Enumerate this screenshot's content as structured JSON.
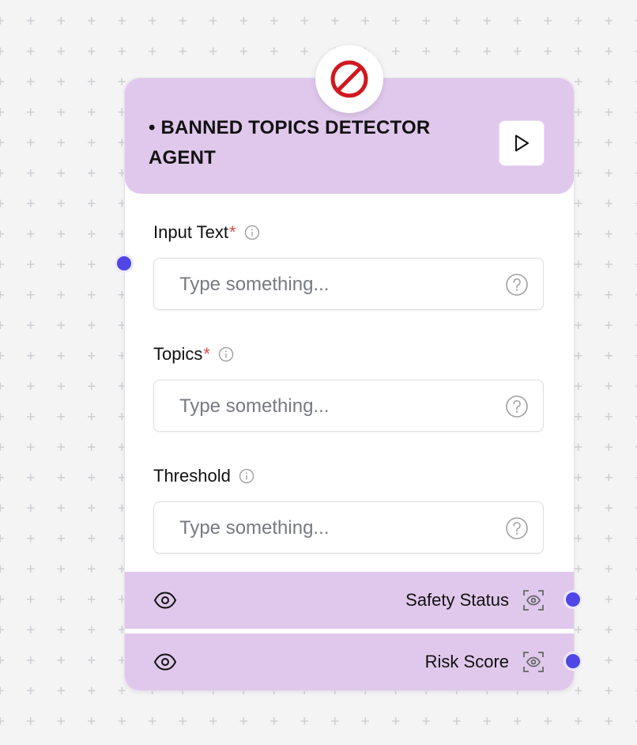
{
  "node": {
    "title": "• BANNED TOPICS DETECTOR AGENT",
    "badge_icon": "no-entry-icon",
    "run_icon": "play-icon",
    "accent_color": "#e0c8ec",
    "handle_color": "#4f46e5"
  },
  "fields": {
    "input_text": {
      "label": "Input Text",
      "required_mark": "*",
      "placeholder": "Type something..."
    },
    "topics": {
      "label": "Topics",
      "required_mark": "*",
      "placeholder": "Type something..."
    },
    "threshold": {
      "label": "Threshold",
      "placeholder": "Type something..."
    }
  },
  "outputs": {
    "safety_status": {
      "label": "Safety Status"
    },
    "risk_score": {
      "label": "Risk Score"
    }
  }
}
